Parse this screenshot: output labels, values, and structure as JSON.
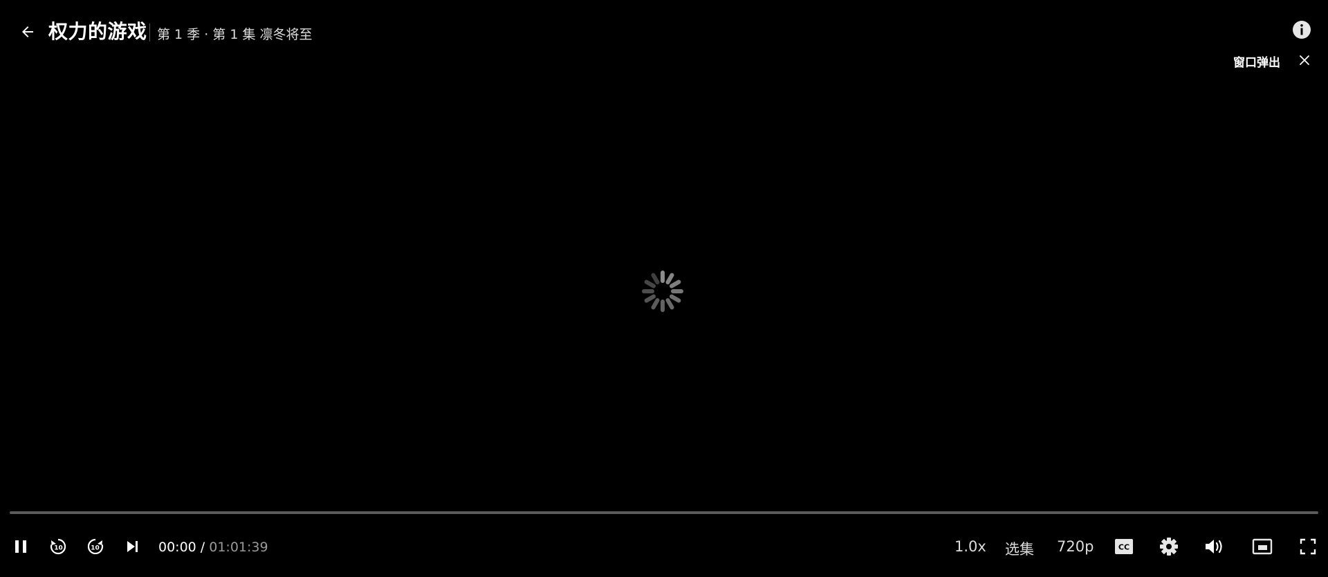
{
  "header": {
    "title": "权力的游戏",
    "subtitle": "第 1 季 · 第 1 集 凛冬将至",
    "back_icon": "arrow-left-icon",
    "info_icon": "info-circle-icon"
  },
  "popout": {
    "label": "窗口弹出",
    "close_icon": "close-icon"
  },
  "player": {
    "state": "loading",
    "spinner_icon": "loading-spinner-icon",
    "progress_fraction": 0.0,
    "progress_color": "#e50914",
    "track_color": "#5a5a5a"
  },
  "controls": {
    "current_time": "00:00",
    "separator": " / ",
    "duration": "01:01:39",
    "speed_label": "1.0x",
    "episodes_label": "选集",
    "quality_label": "720p",
    "icons": {
      "pause": "pause-icon",
      "rewind": "rewind-10-icon",
      "forward": "forward-10-icon",
      "next": "next-episode-icon",
      "subtitles": "cc-icon",
      "settings": "gear-icon",
      "volume": "volume-icon",
      "miniplayer": "miniplayer-icon",
      "fullscreen": "fullscreen-icon"
    }
  }
}
